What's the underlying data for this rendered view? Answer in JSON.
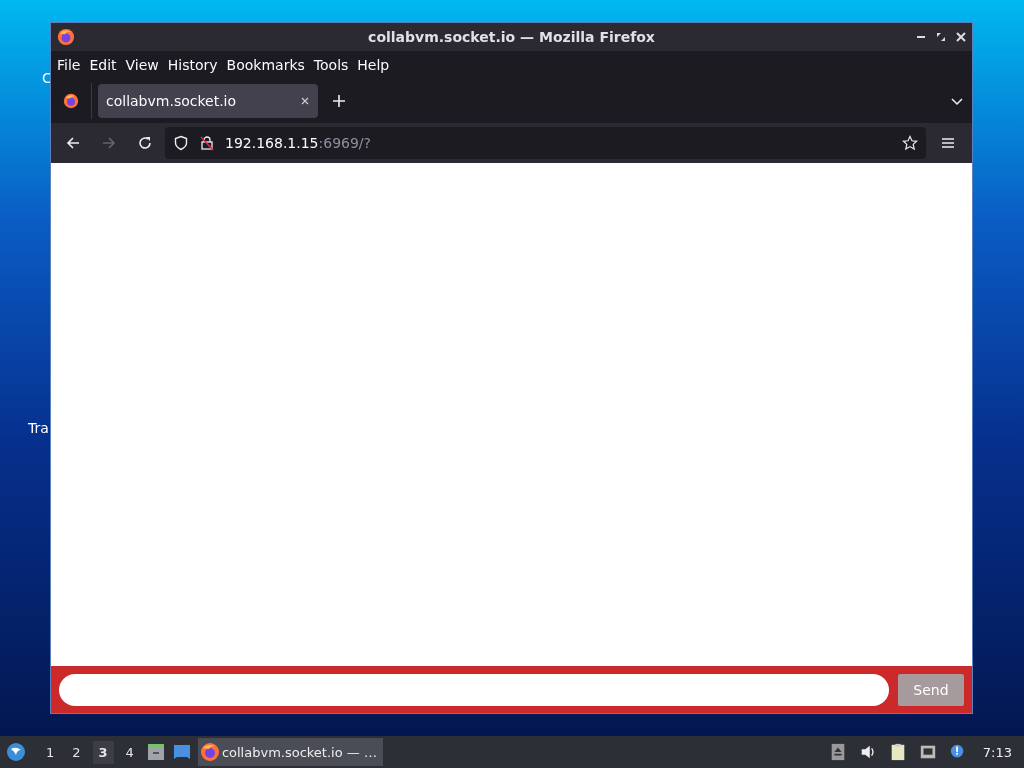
{
  "desktop": {
    "icon_labels": [
      {
        "label": "C"
      },
      {
        "label": "Tra"
      }
    ]
  },
  "window": {
    "title": "collabvm.socket.io — Mozilla Firefox"
  },
  "menu_bar": {
    "items": [
      "File",
      "Edit",
      "View",
      "History",
      "Bookmarks",
      "Tools",
      "Help"
    ]
  },
  "tabs": [
    {
      "label": "collabvm.socket.io",
      "selected": true
    }
  ],
  "nav_bar": {
    "back_disabled": false,
    "forward_disabled": true,
    "url_host": "192.168.1.15",
    "url_rest": ":6969/?"
  },
  "chat": {
    "send_label": "Send"
  },
  "taskbar": {
    "workspaces": [
      {
        "label": "1",
        "selected": false
      },
      {
        "label": "2",
        "selected": false
      },
      {
        "label": "3",
        "selected": true
      },
      {
        "label": "4",
        "selected": false
      }
    ],
    "tasks": [
      {
        "label": "collabvm.socket.io — …",
        "selected": true
      }
    ],
    "clock": "7:13"
  }
}
